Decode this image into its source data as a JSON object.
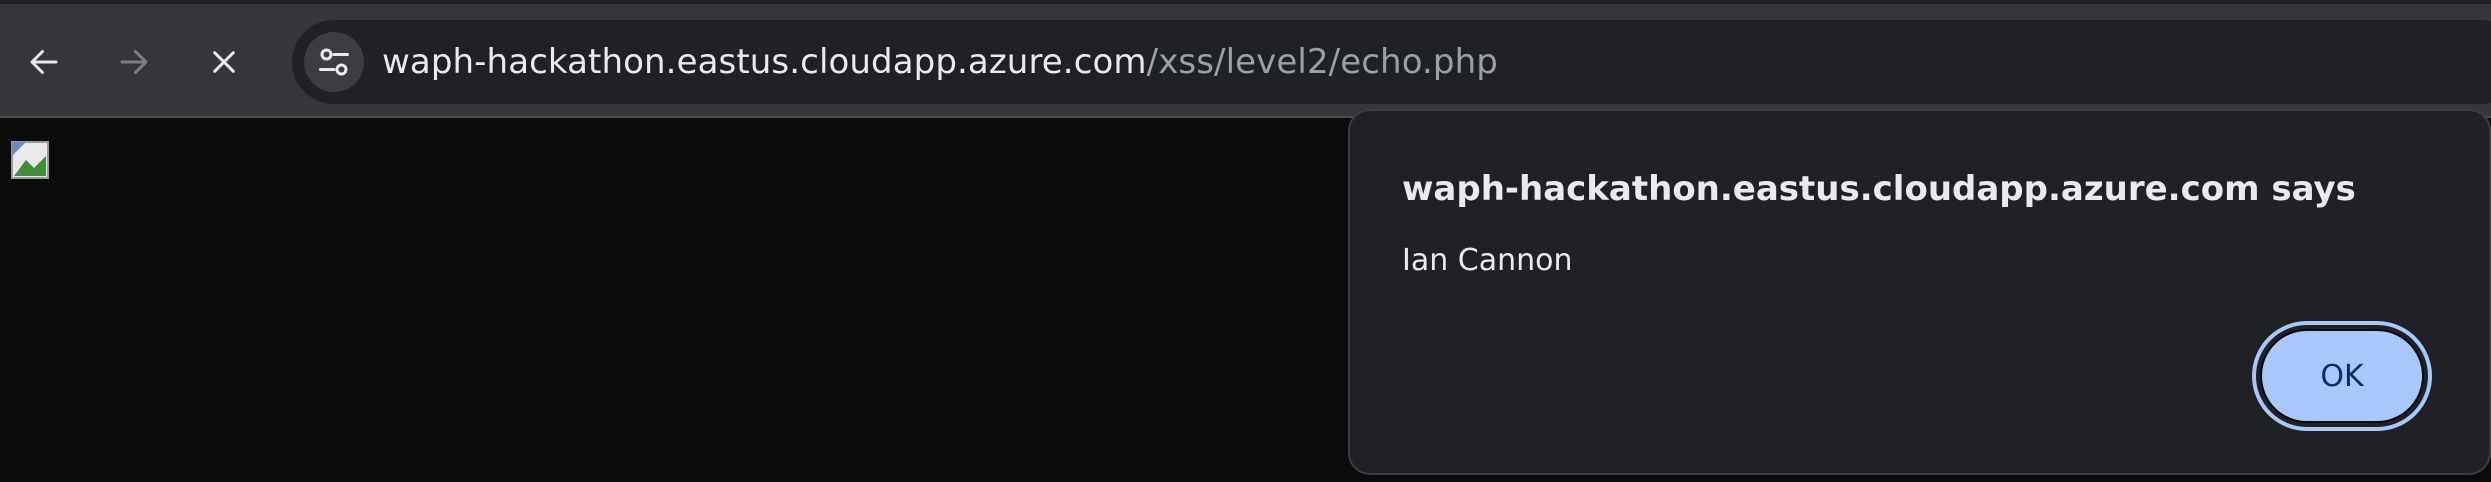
{
  "browser": {
    "url_host": "waph-hackathon.eastus.cloudapp.azure.com",
    "url_path": "/xss/level2/echo.php",
    "icons": {
      "back": "arrow-left-icon",
      "forward": "arrow-right-icon",
      "stop": "close-icon",
      "site_info": "tune-icon"
    }
  },
  "page": {
    "content": "broken-image-icon"
  },
  "dialog": {
    "title": "waph-hackathon.eastus.cloudapp.azure.com says",
    "message": "Ian Cannon",
    "ok_label": "OK"
  },
  "colors": {
    "toolbar_bg": "#35363a",
    "omnibox_bg": "#202124",
    "page_bg": "#0b0b0b",
    "dialog_bg": "#202124",
    "ok_button_bg": "#a8c7fa",
    "ok_button_text": "#062e6f"
  }
}
